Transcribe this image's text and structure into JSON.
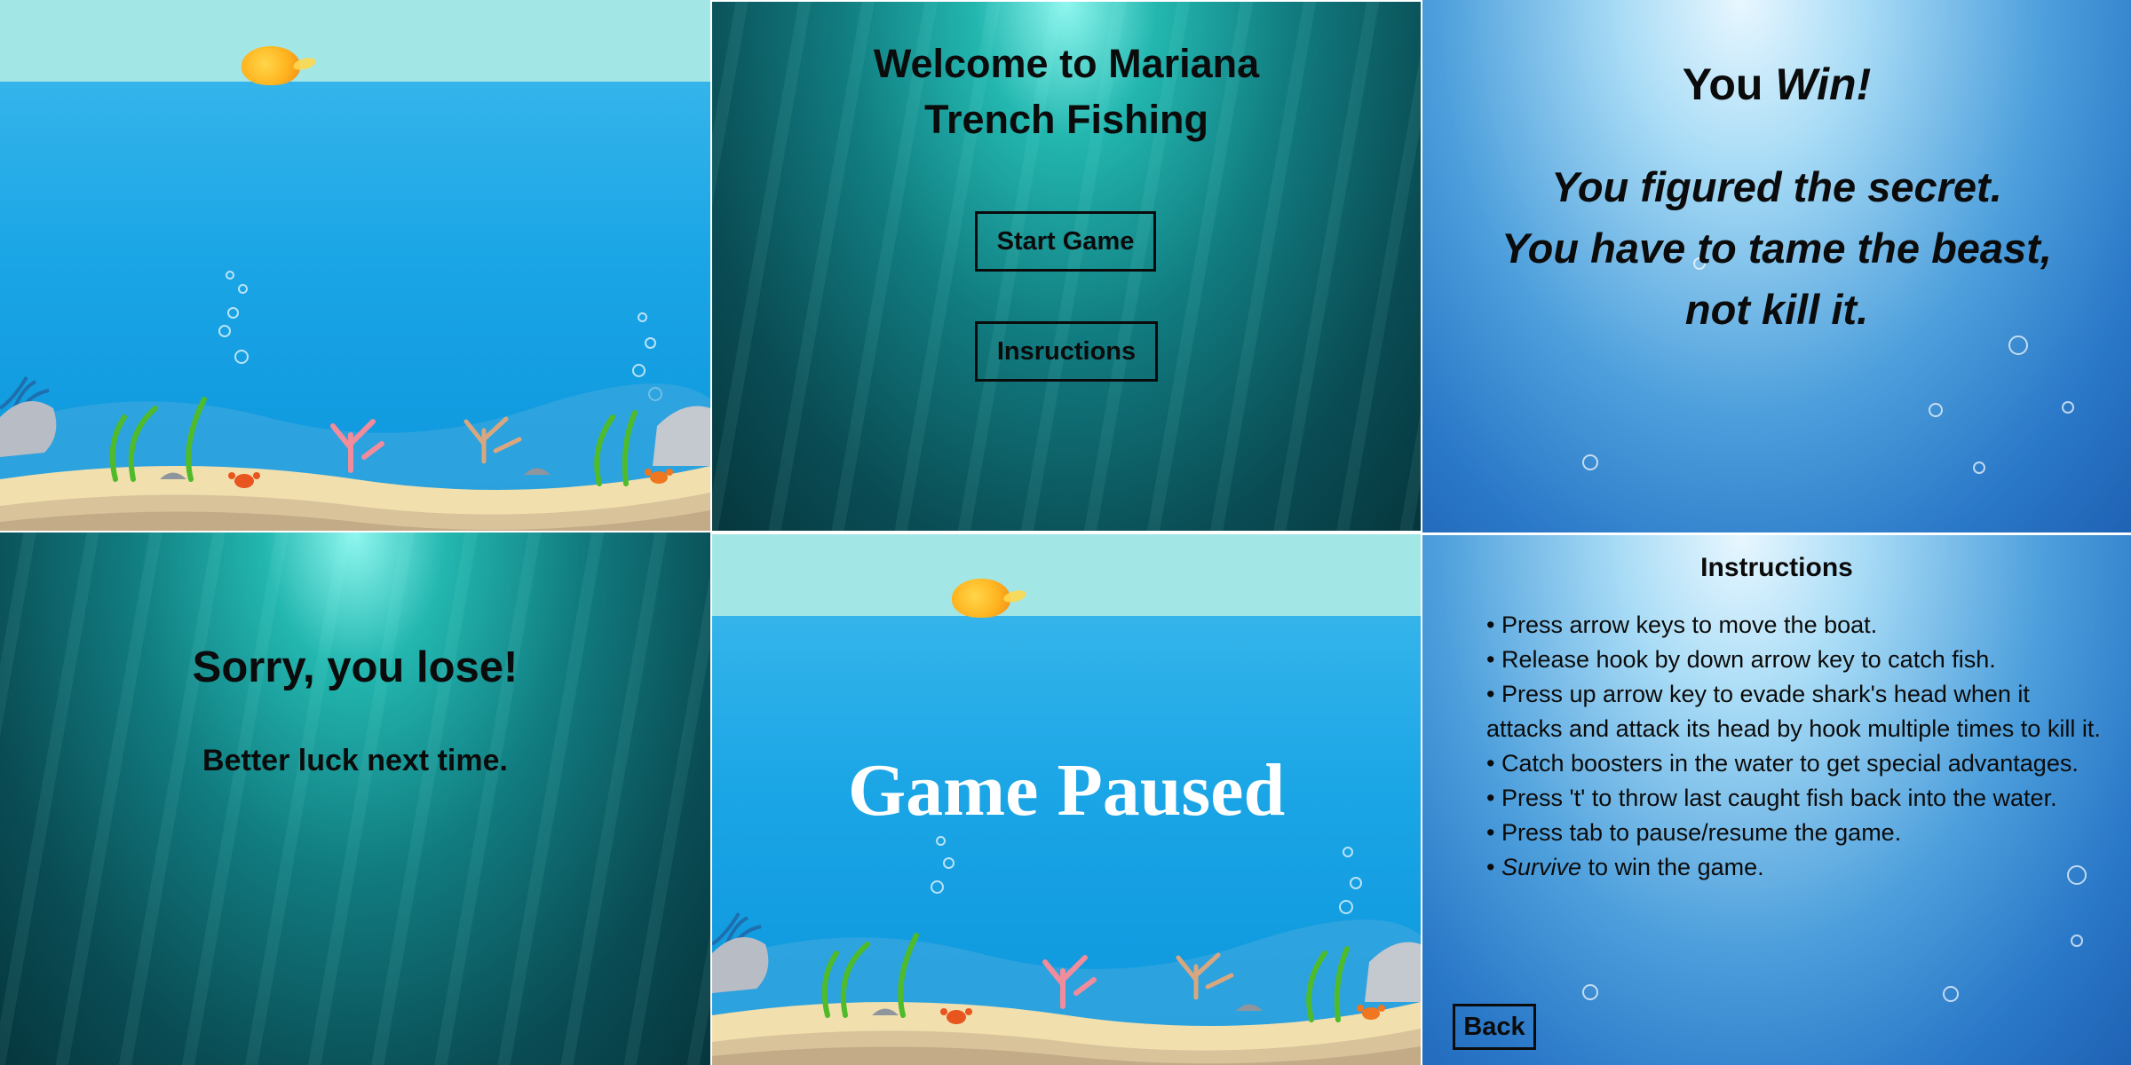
{
  "start_screen": {
    "title_line1": "Welcome to Mariana",
    "title_line2": "Trench Fishing",
    "start_button": "Start Game",
    "instructions_button": "Insructions"
  },
  "win_screen": {
    "heading_prefix": "You",
    "heading_emph": "Win!",
    "message_line1": "You figured the secret.",
    "message_line2": "You have to tame the beast,",
    "message_line3": "not kill it."
  },
  "lose_screen": {
    "heading": "Sorry, you lose!",
    "subtext": "Better luck next time."
  },
  "pause_screen": {
    "label": "Game Paused"
  },
  "instructions_screen": {
    "heading": "Instructions",
    "items": [
      {
        "bullet": "•",
        "text": " Press arrow keys to move the boat."
      },
      {
        "bullet": "•",
        "text": " Release hook by down arrow key to catch fish."
      },
      {
        "bullet": "•",
        "text": " Press up arrow key to evade shark's head when it attacks and attack its head by hook multiple times to kill it."
      },
      {
        "bullet": "•",
        "text": " Catch boosters in the water to get special advantages."
      },
      {
        "bullet": "•",
        "text": " Press 't' to throw last caught fish back into the water."
      },
      {
        "bullet": "•",
        "text": " Press tab to pause/resume the game."
      }
    ],
    "last_item_emph": "Survive",
    "last_item_rest": " to win the game.",
    "back_button": "Back"
  },
  "colors": {
    "sky": "#a3e6e6",
    "sea": "#1aa5e6",
    "deep_sea": "#0a4d55",
    "sand": "#f1dfae"
  },
  "icons": [
    "sun-icon",
    "crab-icon",
    "coral-icon",
    "seaweed-icon",
    "rock-icon",
    "bubble-icon"
  ]
}
